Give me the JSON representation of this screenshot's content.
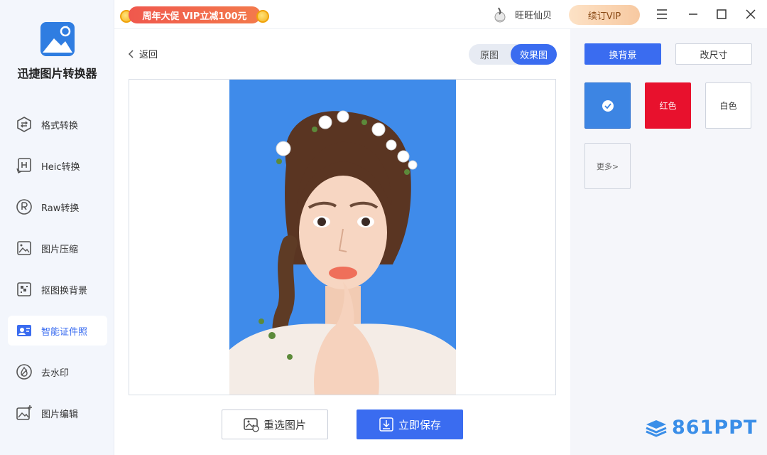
{
  "app": {
    "name": "迅捷图片转换器"
  },
  "sidebar": {
    "items": [
      {
        "label": "格式转换",
        "icon": "format-convert-icon"
      },
      {
        "label": "Heic转换",
        "icon": "heic-icon"
      },
      {
        "label": "Raw转换",
        "icon": "raw-icon"
      },
      {
        "label": "图片压缩",
        "icon": "compress-icon"
      },
      {
        "label": "抠图换背景",
        "icon": "cutout-icon"
      },
      {
        "label": "智能证件照",
        "icon": "id-photo-icon",
        "active": true
      },
      {
        "label": "去水印",
        "icon": "watermark-remove-icon"
      },
      {
        "label": "图片编辑",
        "icon": "image-edit-icon"
      }
    ]
  },
  "titlebar": {
    "promo": "周年大促 VIP立减100元",
    "username": "旺旺仙贝",
    "renew": "续订VIP"
  },
  "main": {
    "back": "返回",
    "view_toggle": {
      "original": "原图",
      "effect": "效果图",
      "selected": "效果图"
    },
    "reselect": "重选图片",
    "save": "立即保存"
  },
  "panel": {
    "tab_background": "换背景",
    "tab_resize": "改尺寸",
    "colors": [
      {
        "label": "",
        "hex": "#3d85e3",
        "selected": true
      },
      {
        "label": "红色",
        "hex": "#e8112d"
      },
      {
        "label": "白色",
        "hex": "#ffffff"
      }
    ],
    "more": "更多>"
  },
  "watermark": "861PPT",
  "colors": {
    "accent": "#3a6cf0",
    "photo_bg": "#3f8bea",
    "red": "#e8112d"
  }
}
